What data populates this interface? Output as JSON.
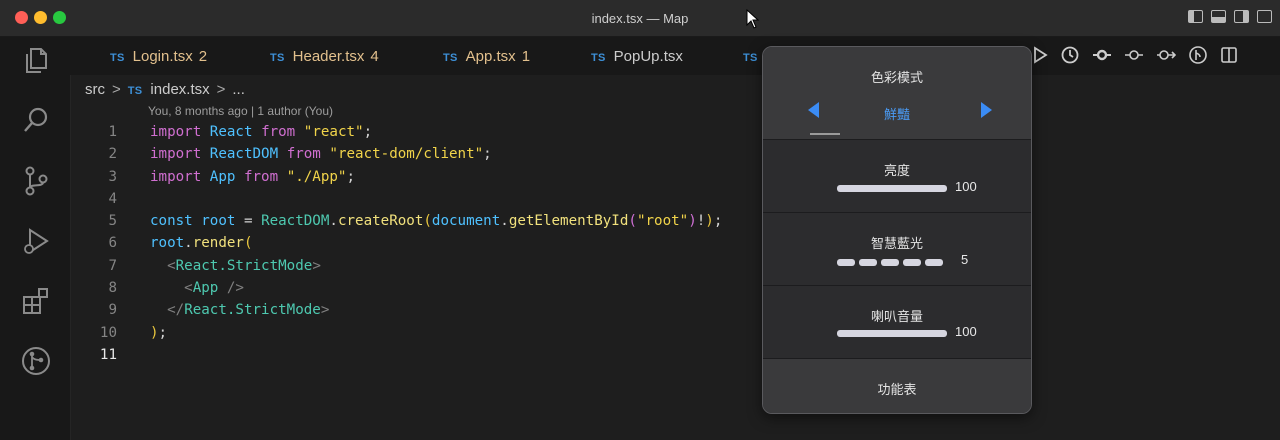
{
  "window": {
    "title": "index.tsx — Map"
  },
  "activity_icons": [
    "explorer-icon",
    "search-icon",
    "source-control-icon",
    "run-debug-icon",
    "extensions-icon",
    "git-graph-icon"
  ],
  "tabs": [
    {
      "lang": "TS",
      "name": "Login.tsx",
      "count": "2"
    },
    {
      "lang": "TS",
      "name": "Header.tsx",
      "count": "4"
    },
    {
      "lang": "TS",
      "name": "App.tsx",
      "count": "1"
    },
    {
      "lang": "TS",
      "name": "PopUp.tsx",
      "count": ""
    },
    {
      "lang": "TS",
      "name": "",
      "count": ""
    }
  ],
  "breadcrumb": {
    "folder": "src",
    "sep": ">",
    "lang": "TS",
    "file": "index.tsx",
    "more": "..."
  },
  "blame": "You, 8 months ago | 1 author (You)",
  "line_numbers": [
    "1",
    "2",
    "3",
    "4",
    "5",
    "6",
    "7",
    "8",
    "9",
    "10",
    "11"
  ],
  "code": {
    "l1": {
      "kw": "import",
      "name": "React",
      "from": "from",
      "str": "\"react\"",
      "end": ";"
    },
    "l2": {
      "kw": "import",
      "name": "ReactDOM",
      "from": "from",
      "str": "\"react-dom/client\"",
      "end": ";"
    },
    "l3": {
      "kw": "import",
      "name": "App",
      "from": "from",
      "str": "\"./App\"",
      "end": ";"
    },
    "l5": {
      "kw": "const",
      "var": "root",
      "eq": " = ",
      "obj": "ReactDOM",
      "dot1": ".",
      "fn1": "createRoot",
      "p1": "(",
      "obj2": "document",
      "dot2": ".",
      "fn2": "getElementById",
      "p2": "(",
      "str": "\"root\"",
      "p3": ")",
      "bang": "!",
      "p4": ")",
      "end": ";"
    },
    "l6": {
      "var": "root",
      "dot": ".",
      "fn": "render",
      "p": "("
    },
    "l7": {
      "open": "<",
      "tag": "React.StrictMode",
      "close": ">"
    },
    "l8": {
      "open": "<",
      "tag": "App",
      "close": " />"
    },
    "l9": {
      "open": "</",
      "tag": "React.StrictMode",
      "close": ">"
    },
    "l10": {
      "p": ")",
      "end": ";"
    }
  },
  "popup": {
    "color_mode": {
      "title": "色彩模式",
      "value": "鮮豔"
    },
    "brightness": {
      "title": "亮度",
      "value": "100",
      "level": 1.0
    },
    "blue_light": {
      "title": "智慧藍光",
      "value": "5",
      "segments": 5
    },
    "speaker_volume": {
      "title": "喇叭音量",
      "value": "100",
      "level": 1.0
    },
    "menu": {
      "label": "功能表"
    }
  },
  "colors": {
    "accent": "#3b8cf5",
    "tab_modified": "#e2c08d",
    "ts_badge": "#3d8fd6"
  }
}
